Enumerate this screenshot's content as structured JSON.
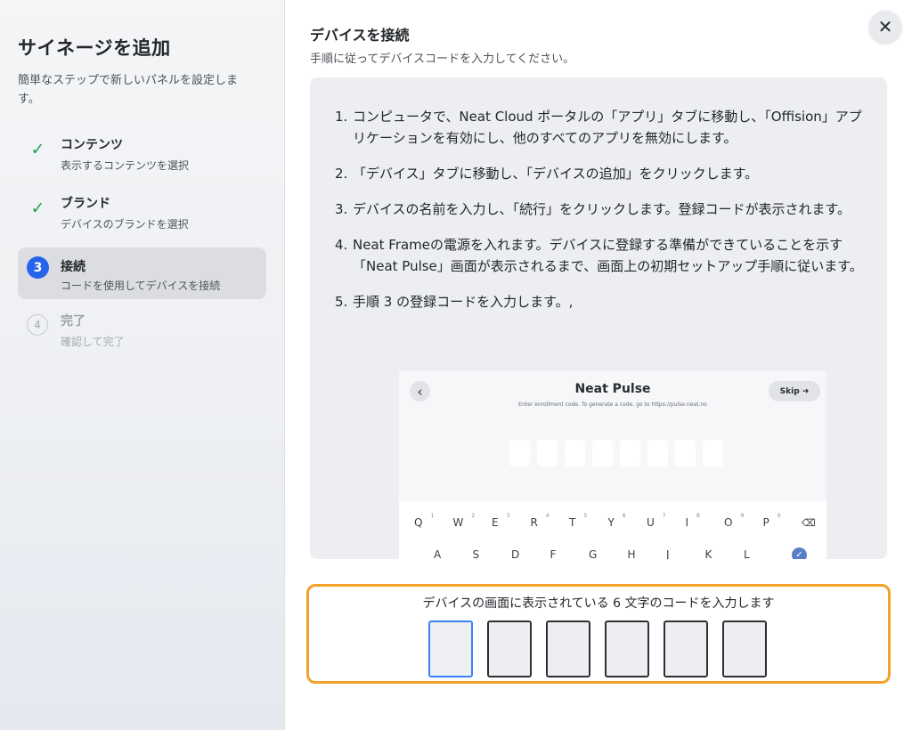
{
  "sidebar": {
    "title": "サイネージを追加",
    "subtitle": "簡単なステップで新しいパネルを設定します。",
    "steps": [
      {
        "marker": "✓",
        "name": "コンテンツ",
        "desc": "表示するコンテンツを選択",
        "state": "done"
      },
      {
        "marker": "✓",
        "name": "ブランド",
        "desc": "デバイスのブランドを選択",
        "state": "done"
      },
      {
        "marker": "3",
        "name": "接続",
        "desc": "コードを使用してデバイスを接続",
        "state": "current"
      },
      {
        "marker": "4",
        "name": "完了",
        "desc": "確認して完了",
        "state": "todo"
      }
    ]
  },
  "main": {
    "title": "デバイスを接続",
    "subtitle": "手順に従ってデバイスコードを入力してください。",
    "close_icon": "close-icon",
    "instructions": [
      {
        "num": "1.",
        "text": "コンピュータで、Neat Cloud ポータルの「アプリ」タブに移動し、「Offision」アプリケーションを有効にし、他のすべてのアプリを無効にします。"
      },
      {
        "num": "2.",
        "text": "「デバイス」タブに移動し、「デバイスの追加」をクリックします。"
      },
      {
        "num": "3.",
        "text": "デバイスの名前を入力し、「続行」をクリックします。登録コードが表示されます。"
      },
      {
        "num": "4.",
        "text": "Neat Frameの電源を入れます。デバイスに登録する準備ができていることを示す「Neat Pulse」画面が表示されるまで、画面上の初期セットアップ手順に従います。"
      },
      {
        "num": "5.",
        "text": "手順 3 の登録コードを入力します。,"
      }
    ],
    "device_screen": {
      "back_icon": "‹",
      "title": "Neat Pulse",
      "subtitle": "Enter enrollment code. To generate a code, go to https://pulse.neat.no",
      "skip_label": "Skip ➜",
      "keyboard_row1": [
        "Q",
        "W",
        "E",
        "R",
        "T",
        "Y",
        "U",
        "I",
        "O",
        "P"
      ],
      "keyboard_row1_nums": [
        "1",
        "2",
        "3",
        "4",
        "5",
        "6",
        "7",
        "8",
        "9",
        "0"
      ],
      "keyboard_row2": [
        "A",
        "S",
        "D",
        "F",
        "G",
        "H",
        "J",
        "K",
        "L"
      ],
      "delete_icon": "⌫",
      "ok_icon": "✓"
    }
  },
  "code_entry": {
    "label": "デバイスの画面に表示されている 6 文字のコードを入力します",
    "values": [
      "",
      "",
      "",
      "",
      "",
      ""
    ]
  },
  "colors": {
    "accent": "#2563eb",
    "done": "#22a455",
    "focus_outline": "#f2a22a"
  }
}
